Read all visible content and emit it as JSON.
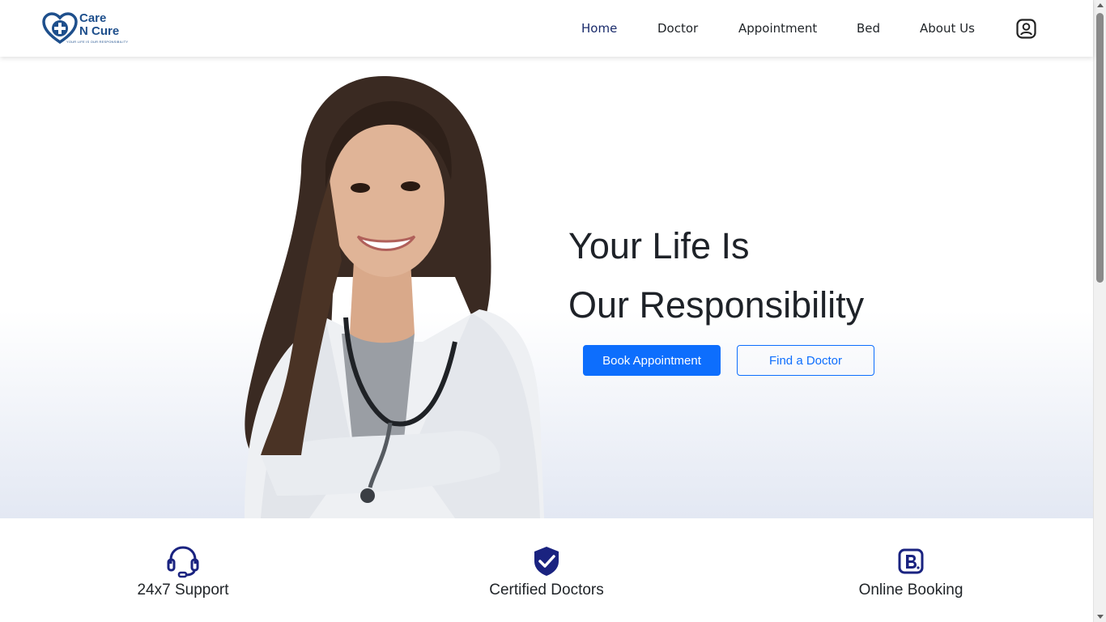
{
  "brand": {
    "line1": "Care",
    "line2": "N Cure",
    "tagline": "YOUR LIFE IS OUR RESPONSIBILITY",
    "accent": "#1e4f8c"
  },
  "nav": {
    "items": [
      {
        "label": "Home",
        "active": true
      },
      {
        "label": "Doctor"
      },
      {
        "label": "Appointment"
      },
      {
        "label": "Bed"
      },
      {
        "label": "About Us"
      }
    ],
    "profile_icon": "user-circle-icon"
  },
  "hero": {
    "title_line1": "Your Life Is",
    "title_line2": "Our Responsibility",
    "primary_button": "Book Appointment",
    "secondary_button": "Find a Doctor",
    "primary_color": "#0d6efd",
    "image": "doctor-photo"
  },
  "features": [
    {
      "label": "24x7 Support",
      "icon": "headset-icon"
    },
    {
      "label": "Certified Doctors",
      "icon": "shield-check-icon"
    },
    {
      "label": "Online Booking",
      "icon": "booking-b-icon"
    }
  ],
  "colors": {
    "icon_navy": "#1a2380",
    "nav_active": "#1a2b6b"
  }
}
